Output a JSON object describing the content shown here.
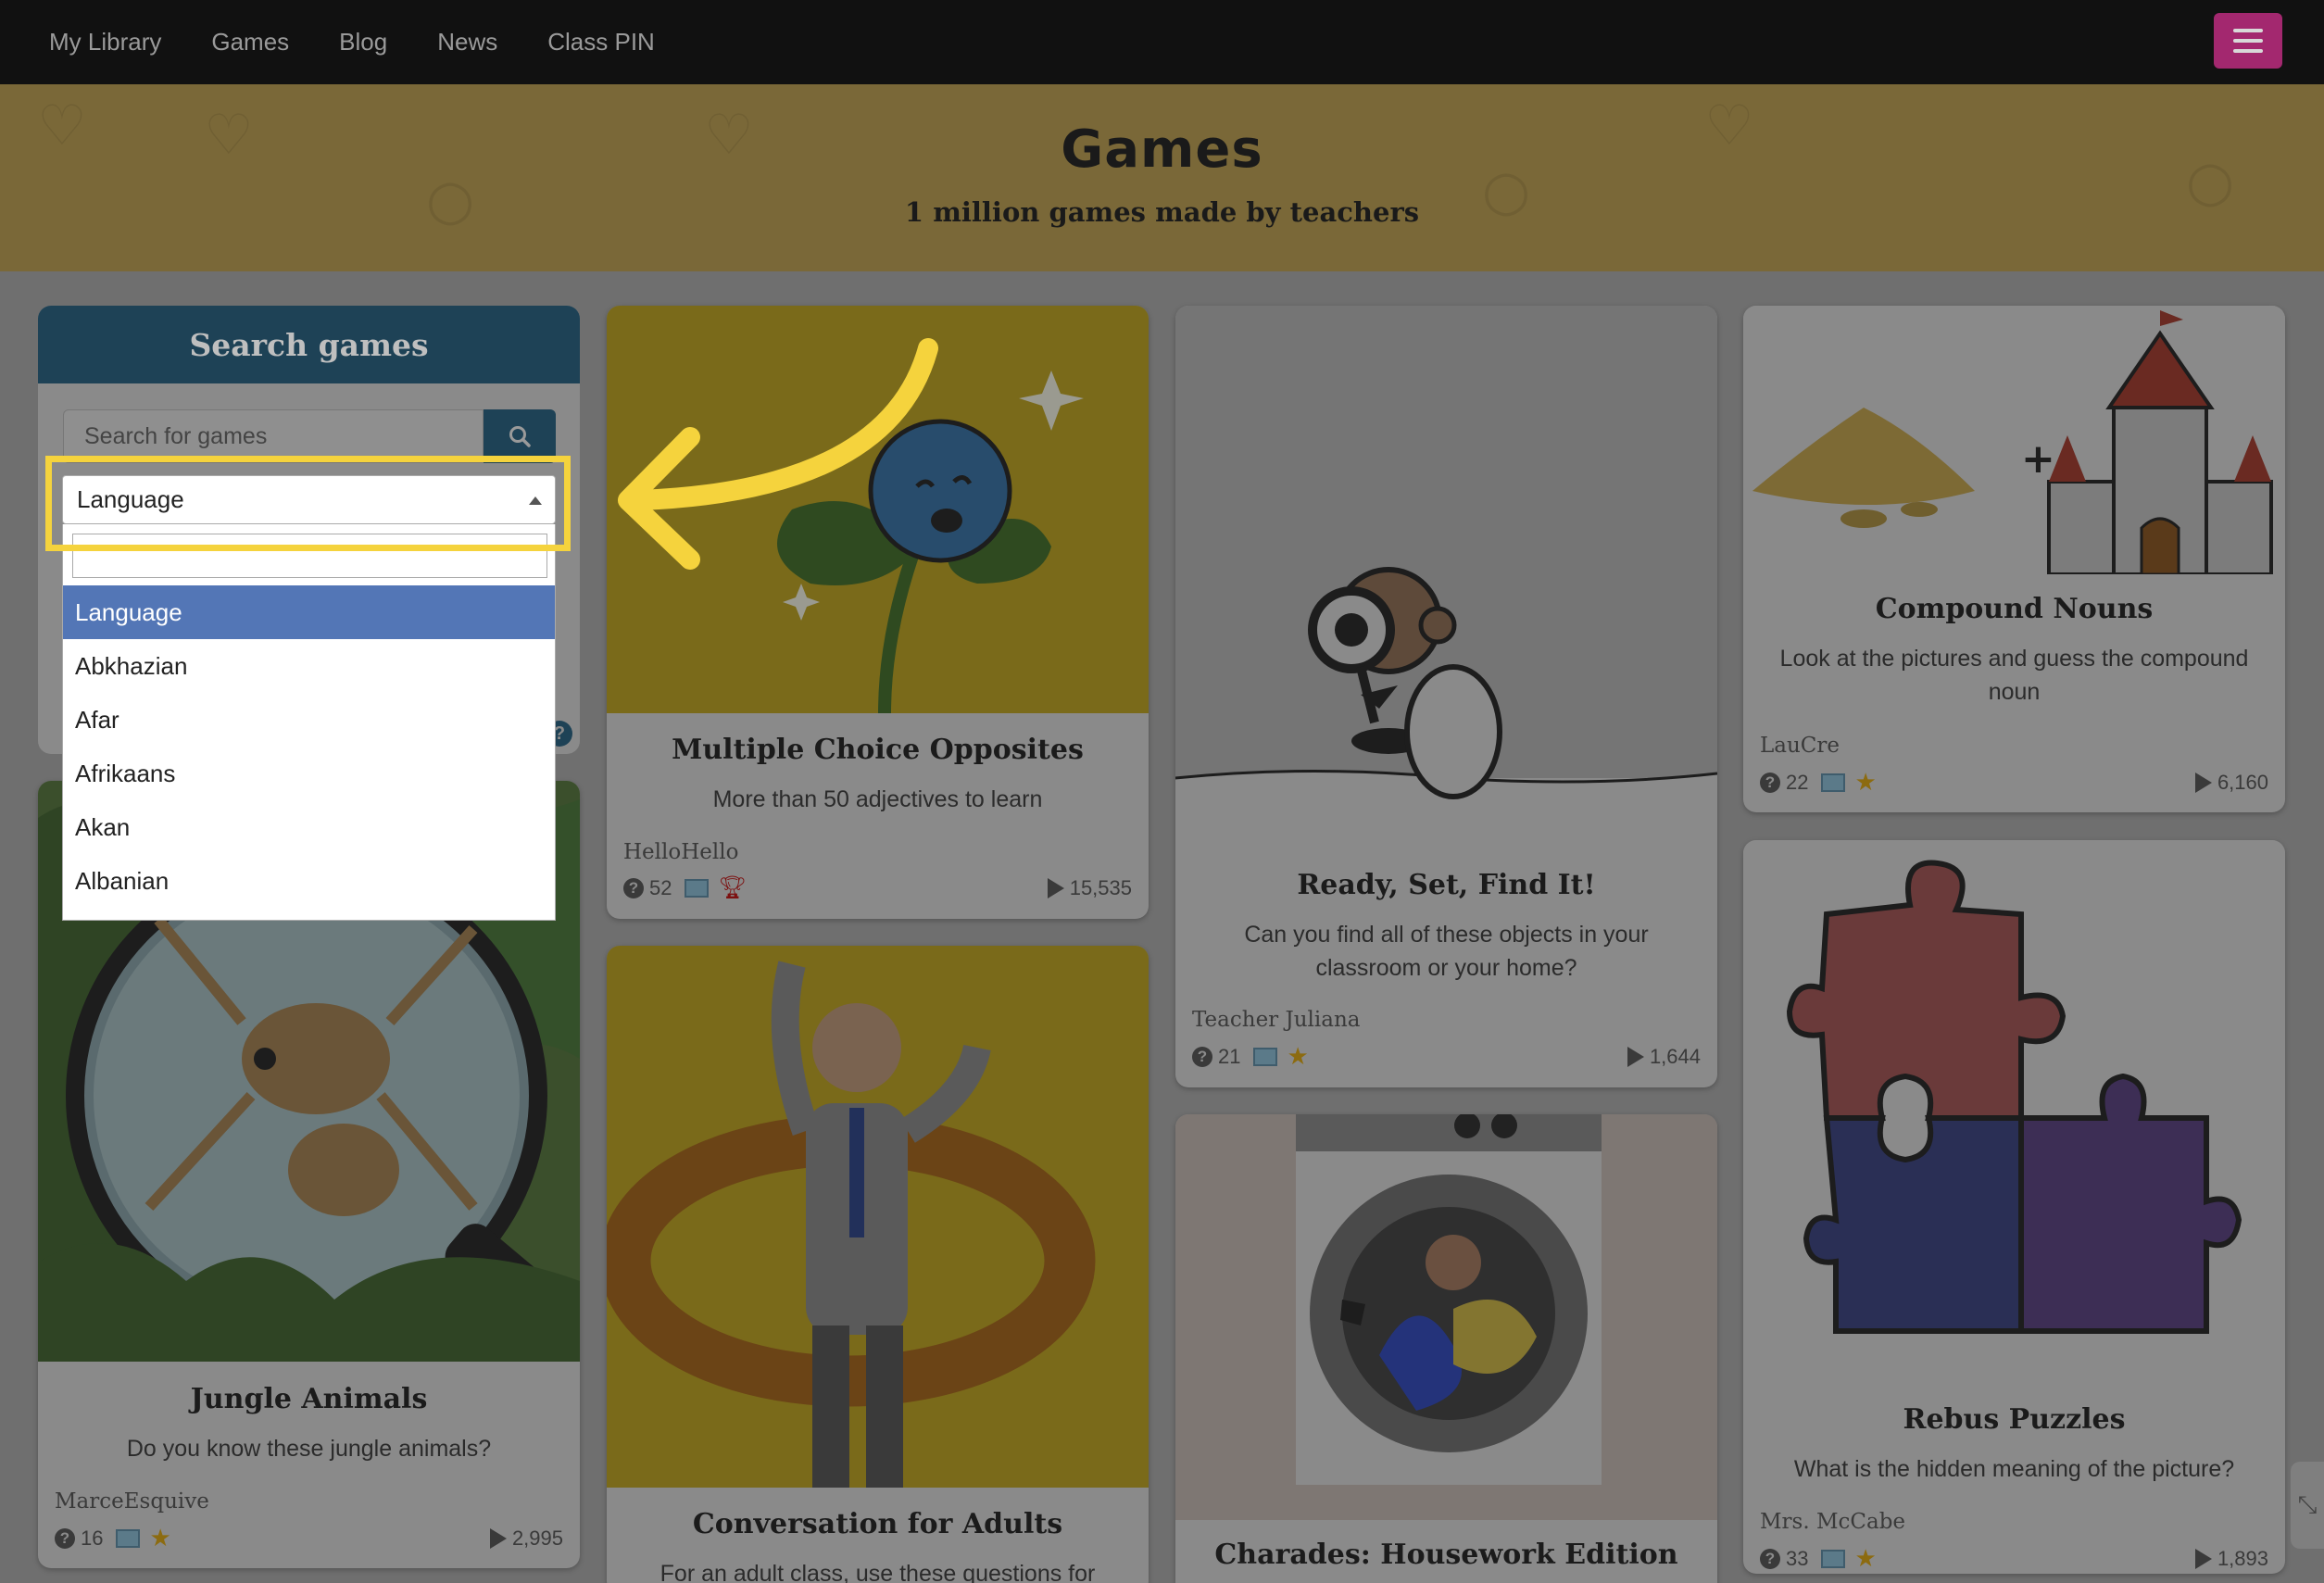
{
  "nav": {
    "items": [
      "My Library",
      "Games",
      "Blog",
      "News",
      "Class PIN"
    ]
  },
  "hero": {
    "title": "Games",
    "subtitle": "1 million games made by teachers"
  },
  "search": {
    "heading": "Search games",
    "placeholder": "Search for games"
  },
  "language_select": {
    "selected": "Language",
    "options": [
      "Language",
      "Abkhazian",
      "Afar",
      "Afrikaans",
      "Akan",
      "Albanian"
    ]
  },
  "cards": [
    {
      "title": "Multiple Choice Opposites",
      "description": "More than 50 adjectives to learn",
      "author": "HelloHello",
      "questions": "52",
      "plays": "15,535",
      "badge": "trophy"
    },
    {
      "title": "Ready, Set, Find It!",
      "description": "Can you find all of these objects in your classroom or your home?",
      "author": "Teacher Juliana",
      "questions": "21",
      "plays": "1,644",
      "badge": "star"
    },
    {
      "title": "Compound Nouns",
      "description": "Look at the pictures and guess the compound noun",
      "author": "LauCre",
      "questions": "22",
      "plays": "6,160",
      "badge": "star"
    },
    {
      "title": "Jungle Animals",
      "description": "Do you know these jungle animals?",
      "author": "MarceEsquive",
      "questions": "16",
      "plays": "2,995",
      "badge": "star"
    },
    {
      "title": "Conversation for Adults",
      "description": "For an adult class, use these questions for"
    },
    {
      "title": "Charades: Housework Edition"
    },
    {
      "title": "Rebus Puzzles",
      "description": "What is the hidden meaning of the picture?",
      "author": "Mrs. McCabe",
      "questions": "33",
      "plays": "1,893",
      "badge": "star"
    }
  ],
  "colors": {
    "nav_bg": "#111111",
    "hero_bg": "#7a6838",
    "search_header": "#1e4256",
    "menu_button": "#a3286f",
    "highlight": "#f5d33d",
    "active_option": "#5376b6"
  },
  "icons": [
    "hamburger-menu-icon",
    "search-icon",
    "help-icon",
    "question-icon",
    "image-icon",
    "star-icon",
    "trophy-icon",
    "play-icon",
    "arrow-annotation"
  ]
}
